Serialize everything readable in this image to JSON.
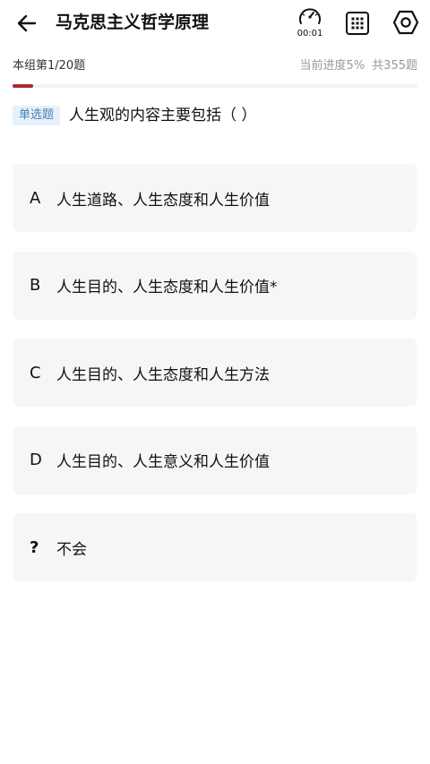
{
  "header": {
    "title": "马克思主义哲学原理",
    "timer": "00:01",
    "icons": {
      "back": "arrow-left-icon",
      "timer": "stopwatch-icon",
      "grid": "grid-icon",
      "settings": "settings-icon"
    }
  },
  "progress": {
    "group_label": "本组第1/20题",
    "current": "当前进度5%",
    "total": "共355题",
    "fraction": 0.05,
    "accent_color": "#a8282f"
  },
  "question": {
    "type_badge": "单选题",
    "text": "人生观的内容主要包括（ ）"
  },
  "options": [
    {
      "key": "A",
      "text": "人生道路、人生态度和人生价值"
    },
    {
      "key": "B",
      "text": "人生目的、人生态度和人生价值*"
    },
    {
      "key": "C",
      "text": "人生目的、人生态度和人生方法"
    },
    {
      "key": "D",
      "text": "人生目的、人生意义和人生价值"
    },
    {
      "key": "?",
      "text": "不会"
    }
  ]
}
